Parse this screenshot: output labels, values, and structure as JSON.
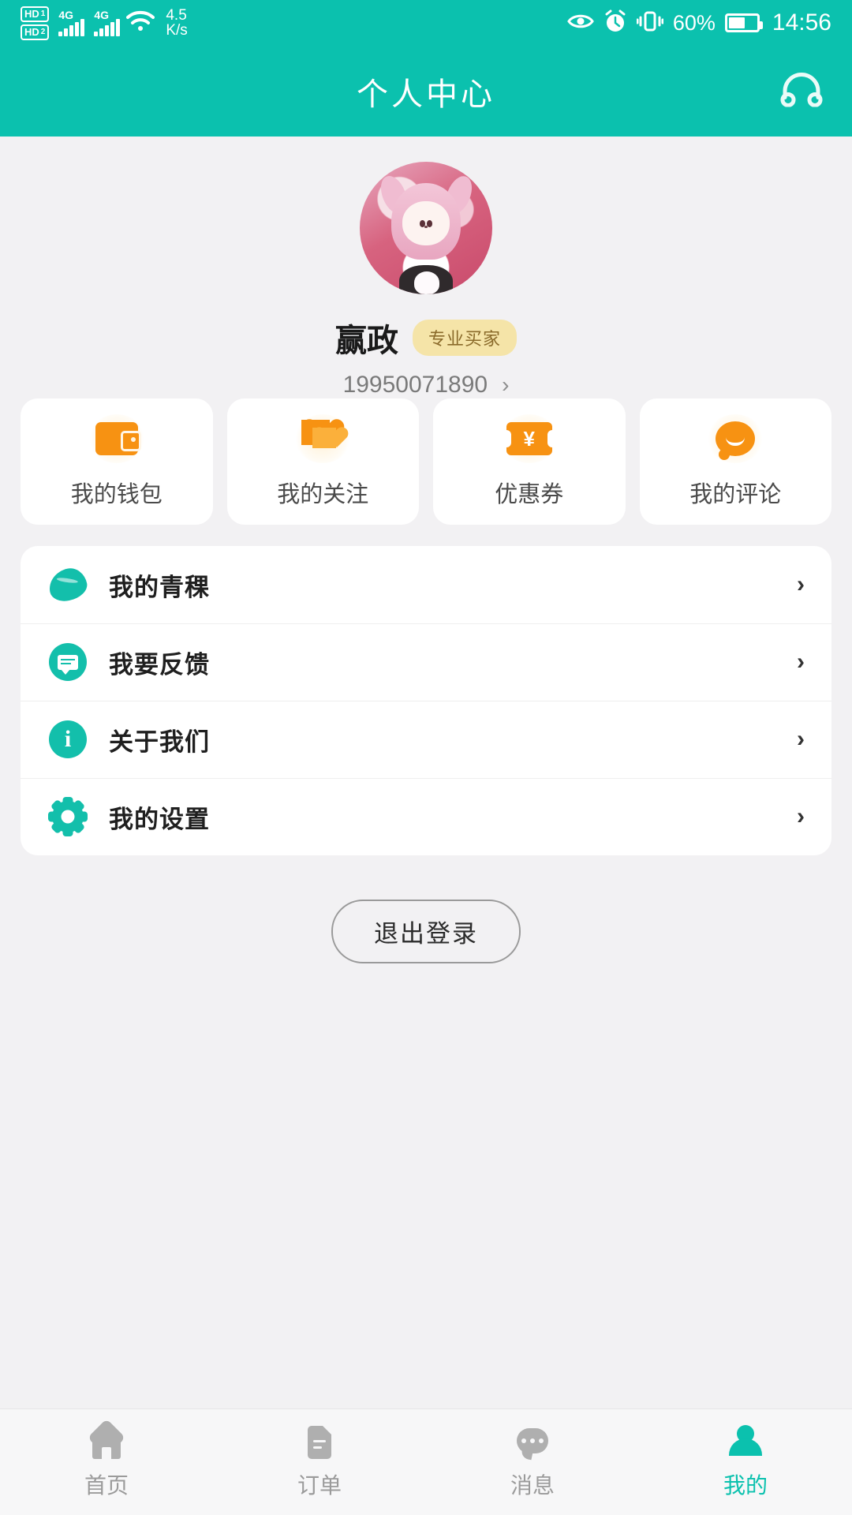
{
  "status_bar": {
    "hd_chips": [
      {
        "label": "HD",
        "num": "1"
      },
      {
        "label": "HD",
        "num": "2"
      }
    ],
    "sim1_network": "4G",
    "sim2_network": "4G",
    "wifi_icon": "wifi-icon",
    "net_speed_value": "4.5",
    "net_speed_unit": "K/s",
    "eye_icon": "eye-care-icon",
    "alarm_icon": "alarm-clock-icon",
    "vibrate_icon": "vibrate-icon",
    "battery_percent": "60%",
    "battery_icon": "battery-icon",
    "time": "14:56"
  },
  "header": {
    "title": "个人中心",
    "action_icon": "headset-icon"
  },
  "profile": {
    "avatar_icon": "user-avatar",
    "name": "赢政",
    "badge": "专业买家",
    "phone": "19950071890",
    "chevron": "›"
  },
  "quick_cards": [
    {
      "label": "我的钱包",
      "icon": "wallet-icon"
    },
    {
      "label": "我的关注",
      "icon": "hearts-icon"
    },
    {
      "label": "优惠券",
      "icon": "coupon-icon",
      "symbol": "¥"
    },
    {
      "label": "我的评论",
      "icon": "comment-bubble-icon"
    }
  ],
  "menu_rows": [
    {
      "label": "我的青稞",
      "icon": "leaf-icon",
      "chevron": "›"
    },
    {
      "label": "我要反馈",
      "icon": "feedback-chat-icon",
      "chevron": "›"
    },
    {
      "label": "关于我们",
      "icon": "info-icon",
      "chevron": "›"
    },
    {
      "label": "我的设置",
      "icon": "gear-icon",
      "chevron": "›"
    }
  ],
  "logout": {
    "label": "退出登录"
  },
  "bottom_nav": [
    {
      "label": "首页",
      "icon": "home-icon",
      "active": false
    },
    {
      "label": "订单",
      "icon": "document-icon",
      "active": false
    },
    {
      "label": "消息",
      "icon": "message-bubble-icon",
      "active": false
    },
    {
      "label": "我的",
      "icon": "person-icon",
      "active": true
    }
  ],
  "colors": {
    "brand_teal": "#0BC1AE",
    "icon_teal": "#13BFAB",
    "accent_orange": "#F79212",
    "badge_gold": "#F5E4A8",
    "page_background": "#F2F1F3",
    "card_white": "#FFFFFF",
    "nav_inactive": "#9B9B9B"
  }
}
